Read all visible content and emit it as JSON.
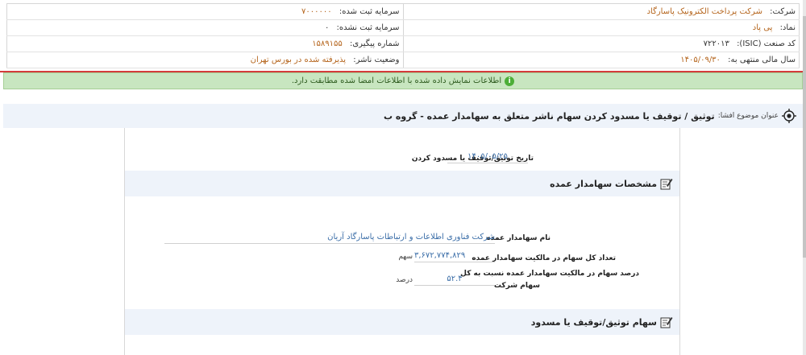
{
  "company": {
    "company_label": "شرکت:",
    "company_value": "شرکت پرداخت الکترونیک پاسارگاد",
    "registered_capital_label": "سرمایه ثبت شده:",
    "registered_capital_value": "۷۰۰۰۰۰۰",
    "symbol_label": "نماد:",
    "symbol_value": "پی پاد",
    "unregistered_capital_label": "سرمایه ثبت نشده:",
    "unregistered_capital_value": "۰",
    "isic_label": "کد صنعت (ISIC):",
    "isic_value": "۷۲۲۰۱۳",
    "tracking_label": "شماره پیگیری:",
    "tracking_value": "۱۵۸۹۱۵۵",
    "fiscal_year_label": "سال مالی منتهی به:",
    "fiscal_year_value": "۱۴۰۵/۰۹/۳۰",
    "publisher_status_label": "وضعیت ناشر:",
    "publisher_status_value": "پذیرفته شده در بورس تهران"
  },
  "alert": {
    "text": "اطلاعات نمایش داده شده با اطلاعات امضا شده مطابقت دارد.",
    "icon": "info-icon"
  },
  "subject": {
    "label": "عنوان موضوع افشا:",
    "value": "توثیق / توقیف یا مسدود کردن سهام ناشر متعلق به سهامدار عمده - گروه ب",
    "icon": "target-icon"
  },
  "form": {
    "date_label": "تاریخ توثیق/توقیف یا مسدود کردن",
    "date_value": "۱۴۰۵/۰۵/۲۵"
  },
  "section1": {
    "title": "مشخصات سهامدار عمده",
    "icon": "edit-icon",
    "name_label": "نام سهامدار عمده",
    "name_value": "شرکت فناوری اطلاعات و ارتباطات پاسارگاد آریان",
    "shares_label": "تعداد کل سهام در مالکیت سهامدار عمده",
    "shares_value": "۳,۶۷۲,۷۷۴,۸۲۹",
    "shares_unit": "سهم",
    "percent_label_1": "درصد سهام در مالکیت سهامدار عمده نسبت به کل",
    "percent_label_2": "سهام شرکت",
    "percent_value": "۵۲.۴",
    "percent_unit": "درصد"
  },
  "section2": {
    "title": "سهام توثیق/توقیف یا مسدود",
    "icon": "edit-icon"
  },
  "colors": {
    "accent_red": "#d43b3b",
    "alert_bg": "#c8e6c0",
    "value_orange": "#b5651d",
    "link_blue": "#3b6ea8"
  }
}
